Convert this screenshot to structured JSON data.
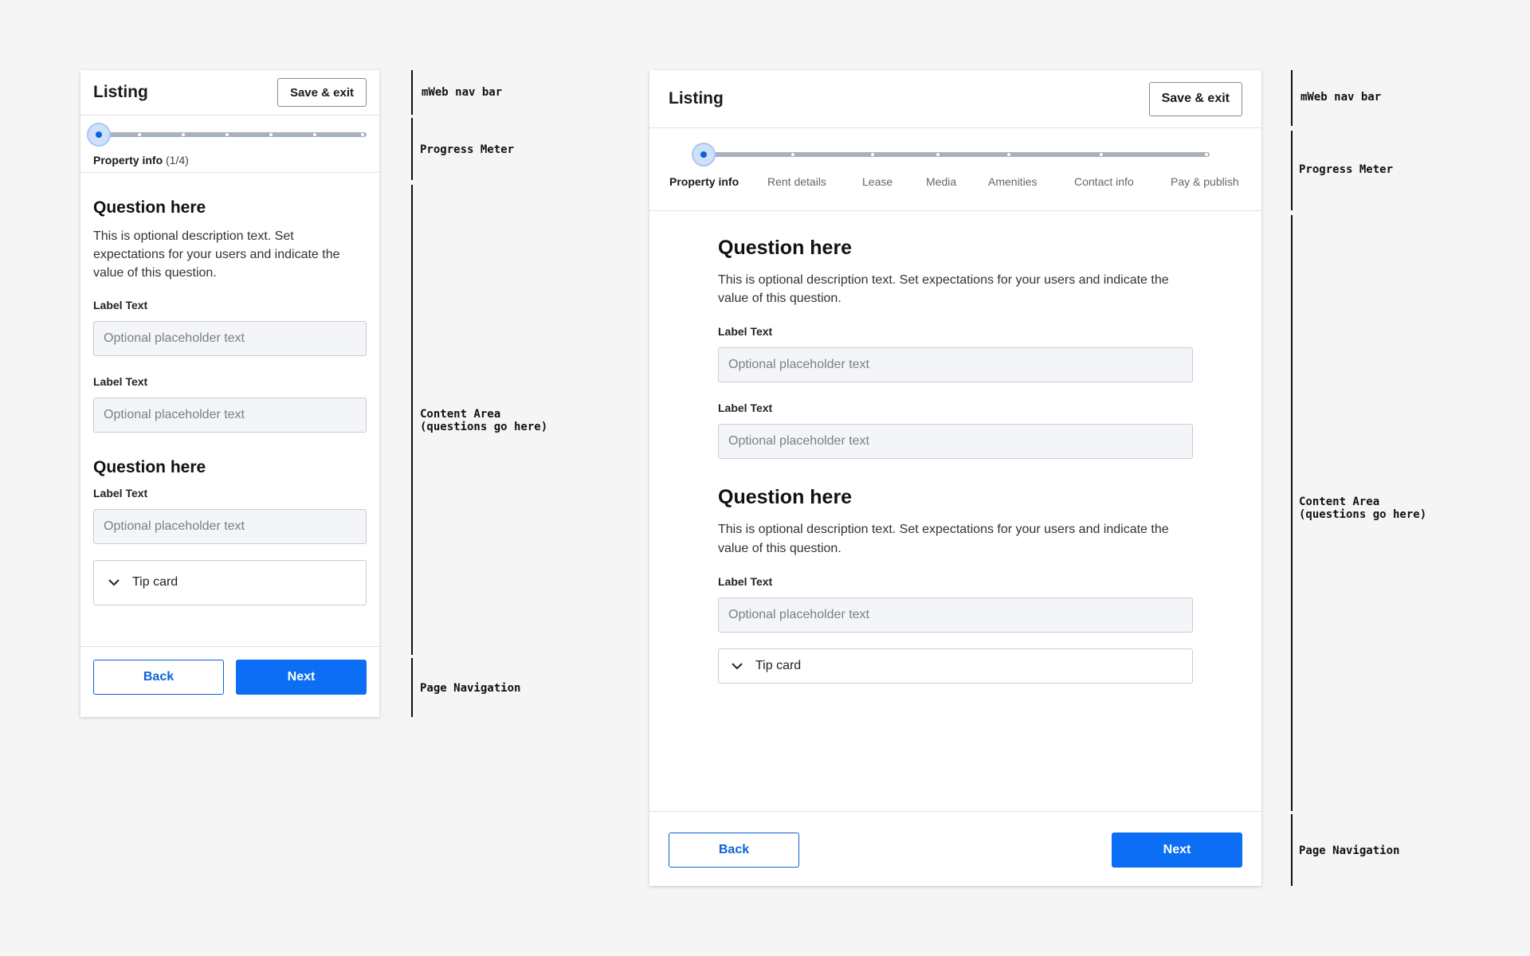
{
  "mobile": {
    "nav": {
      "title": "Listing",
      "save_label": "Save & exit"
    },
    "progress": {
      "step_label": "Property info",
      "step_count": "(1/4)",
      "current_step": 1,
      "total_dots": 7
    },
    "questions": [
      {
        "title": "Question here",
        "description": "This is optional description text. Set expectations for your users and indicate the value of this question.",
        "fields": [
          {
            "label": "Label Text",
            "placeholder": "Optional placeholder text"
          },
          {
            "label": "Label Text",
            "placeholder": "Optional placeholder text"
          }
        ]
      },
      {
        "title": "Question here",
        "fields": [
          {
            "label": "Label Text",
            "placeholder": "Optional placeholder text"
          }
        ]
      }
    ],
    "tip_card": {
      "label": "Tip card",
      "icon": "chevron-down-icon"
    },
    "page_nav": {
      "back_label": "Back",
      "next_label": "Next"
    }
  },
  "desktop": {
    "nav": {
      "title": "Listing",
      "save_label": "Save & exit"
    },
    "progress": {
      "steps": [
        "Property info",
        "Rent details",
        "Lease",
        "Media",
        "Amenities",
        "Contact info",
        "Pay & publish"
      ],
      "current_step": 1
    },
    "questions": [
      {
        "title": "Question here",
        "description": "This is optional description text. Set expectations for your users and indicate the value of this question.",
        "fields": [
          {
            "label": "Label Text",
            "placeholder": "Optional placeholder text"
          },
          {
            "label": "Label Text",
            "placeholder": "Optional placeholder text"
          }
        ]
      },
      {
        "title": "Question here",
        "description": "This is optional description text. Set expectations for your users and indicate the value of this question.",
        "fields": [
          {
            "label": "Label Text",
            "placeholder": "Optional placeholder text"
          }
        ]
      }
    ],
    "tip_card": {
      "label": "Tip card",
      "icon": "chevron-down-icon"
    },
    "page_nav": {
      "back_label": "Back",
      "next_label": "Next"
    }
  },
  "annotations": {
    "mobile": {
      "nav": "mWeb nav bar",
      "progress": "Progress Meter",
      "content": "Content Area\n(questions go here)",
      "page_nav": "Page Navigation"
    },
    "desktop": {
      "nav": "mWeb nav bar",
      "progress": "Progress Meter",
      "content": "Content Area\n(questions go here)",
      "page_nav": "Page Navigation"
    }
  },
  "colors": {
    "primary": "#0b6ef5",
    "progress_track": "#a9b1bd",
    "progress_active": "#0b63d8",
    "background": "#f5f5f5"
  }
}
